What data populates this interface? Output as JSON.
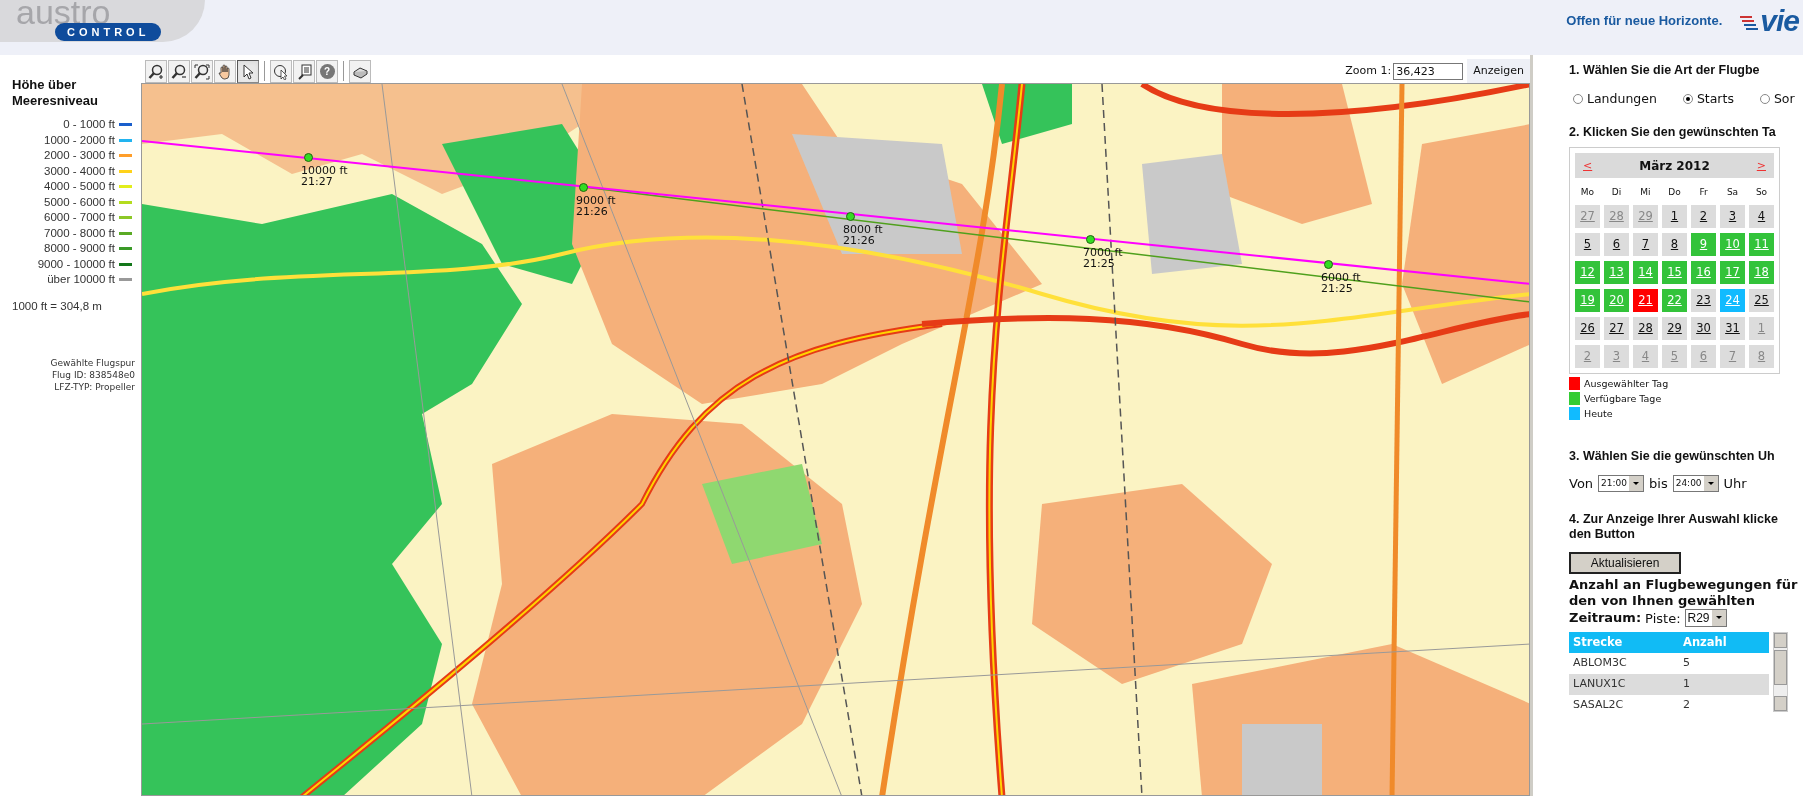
{
  "header": {
    "logo_top": "austro",
    "logo_badge": "CONTROL",
    "slogan": "Offen für neue Horizonte.",
    "airport_logo": "vie"
  },
  "toolbar": {
    "tools": [
      {
        "kind": "zoom_in",
        "selected": false
      },
      {
        "kind": "zoom_out",
        "selected": false
      },
      {
        "kind": "zoom_extent",
        "selected": false
      },
      {
        "kind": "pan",
        "selected": false
      },
      {
        "kind": "pointer",
        "selected": true
      },
      {
        "kind": "select",
        "selected": false
      },
      {
        "kind": "info",
        "selected": false
      },
      {
        "kind": "help",
        "label": "?",
        "selected": false
      },
      {
        "kind": "print",
        "selected": false
      }
    ],
    "zoom_label": "Zoom 1:",
    "zoom_value": "36,423",
    "zoom_button": "Anzeigen"
  },
  "legend": {
    "title": "Höhe über Meeresniveau",
    "items": [
      {
        "label": "0 - 1000 ft",
        "color": "#1a5fcc"
      },
      {
        "label": "1000 - 2000 ft",
        "color": "#22b4f0"
      },
      {
        "label": "2000 - 3000 ft",
        "color": "#ff9e2a"
      },
      {
        "label": "3000 - 4000 ft",
        "color": "#ffd21a"
      },
      {
        "label": "4000 - 5000 ft",
        "color": "#e2ee1c"
      },
      {
        "label": "5000 - 6000 ft",
        "color": "#b4dc1e"
      },
      {
        "label": "6000 - 7000 ft",
        "color": "#8cc828"
      },
      {
        "label": "7000 - 8000 ft",
        "color": "#5aaa24"
      },
      {
        "label": "8000 - 9000 ft",
        "color": "#3a9a28"
      },
      {
        "label": "9000 - 10000 ft",
        "color": "#13771a"
      },
      {
        "label": "über 10000 ft",
        "color": "#999999"
      }
    ],
    "conversion": "1000 ft = 304,8 m"
  },
  "flight_info": [
    "Gewählte Flugspur",
    "Flug ID: 838548e0",
    "LFZ-TYP: Propeller"
  ],
  "map": {
    "waypoints": [
      {
        "altitude": "10000 ft",
        "time": "21:27"
      },
      {
        "altitude": "9000 ft",
        "time": "21:26"
      },
      {
        "altitude": "8000 ft",
        "time": "21:26"
      },
      {
        "altitude": "7000 ft",
        "time": "21:25"
      },
      {
        "altitude": "6000 ft",
        "time": "21:25"
      }
    ]
  },
  "panel": {
    "step1": "1. Wählen Sie die Art  der Flugbe",
    "movement_types": [
      {
        "label": "Landungen",
        "selected": false
      },
      {
        "label": "Starts",
        "selected": true
      },
      {
        "label": "Sor",
        "selected": false
      }
    ],
    "step2": "2. Klicken Sie den gewünschten Ta",
    "calendar": {
      "prev": "<",
      "month": "März 2012",
      "next": ">",
      "weekdays": [
        "Mo",
        "Di",
        "Mi",
        "Do",
        "Fr",
        "Sa",
        "So"
      ],
      "days": [
        {
          "label": "27",
          "kind": "outside",
          "selected": false
        },
        {
          "label": "28",
          "kind": "outside",
          "selected": false
        },
        {
          "label": "29",
          "kind": "outside",
          "selected": false
        },
        {
          "label": "1",
          "kind": "plain",
          "selected": false
        },
        {
          "label": "2",
          "kind": "plain",
          "selected": false
        },
        {
          "label": "3",
          "kind": "plain",
          "selected": false
        },
        {
          "label": "4",
          "kind": "plain",
          "selected": false
        },
        {
          "label": "5",
          "kind": "plain",
          "selected": false
        },
        {
          "label": "6",
          "kind": "plain",
          "selected": false
        },
        {
          "label": "7",
          "kind": "plain",
          "selected": false
        },
        {
          "label": "8",
          "kind": "plain",
          "selected": false
        },
        {
          "label": "9",
          "kind": "available",
          "selected": false
        },
        {
          "label": "10",
          "kind": "available",
          "selected": false
        },
        {
          "label": "11",
          "kind": "available",
          "selected": false
        },
        {
          "label": "12",
          "kind": "available",
          "selected": false
        },
        {
          "label": "13",
          "kind": "available",
          "selected": false
        },
        {
          "label": "14",
          "kind": "available",
          "selected": false
        },
        {
          "label": "15",
          "kind": "available",
          "selected": false
        },
        {
          "label": "16",
          "kind": "available",
          "selected": false
        },
        {
          "label": "17",
          "kind": "available",
          "selected": false
        },
        {
          "label": "18",
          "kind": "available",
          "selected": false
        },
        {
          "label": "19",
          "kind": "available",
          "selected": false
        },
        {
          "label": "20",
          "kind": "available",
          "selected": false
        },
        {
          "label": "21",
          "kind": "available",
          "selected": true
        },
        {
          "label": "22",
          "kind": "available",
          "selected": false
        },
        {
          "label": "23",
          "kind": "plain",
          "selected": false
        },
        {
          "label": "24",
          "kind": "today",
          "selected": false
        },
        {
          "label": "25",
          "kind": "plain",
          "selected": false
        },
        {
          "label": "26",
          "kind": "plain",
          "selected": false
        },
        {
          "label": "27",
          "kind": "plain",
          "selected": false
        },
        {
          "label": "28",
          "kind": "plain",
          "selected": false
        },
        {
          "label": "29",
          "kind": "plain",
          "selected": false
        },
        {
          "label": "30",
          "kind": "plain",
          "selected": false
        },
        {
          "label": "31",
          "kind": "plain",
          "selected": false
        },
        {
          "label": "1",
          "kind": "outside",
          "selected": false
        },
        {
          "label": "2",
          "kind": "outside",
          "selected": false
        },
        {
          "label": "3",
          "kind": "outside",
          "selected": false
        },
        {
          "label": "4",
          "kind": "outside",
          "selected": false
        },
        {
          "label": "5",
          "kind": "outside",
          "selected": false
        },
        {
          "label": "6",
          "kind": "outside",
          "selected": false
        },
        {
          "label": "7",
          "kind": "outside",
          "selected": false
        },
        {
          "label": "8",
          "kind": "outside",
          "selected": false
        }
      ]
    },
    "calendar_legend": [
      {
        "label": "Ausgewählter Tag",
        "color": "#ff0000"
      },
      {
        "label": "Verfügbare Tage",
        "color": "#33cc33"
      },
      {
        "label": "Heute",
        "color": "#11bbff"
      }
    ],
    "step3": "3. Wählen Sie die gewünschten Uh",
    "time_from_label": "Von",
    "time_from": "21:00",
    "time_to_label": "bis",
    "time_to": "24:00",
    "time_unit": "Uhr",
    "step4": [
      "4. Zur Anzeige Ihrer Auswahl klicke",
      "den Button"
    ],
    "update_button": "Aktualisieren",
    "count_title": [
      "Anzahl an Flugbewegungen für",
      "den von Ihnen gewählten",
      "Zeitraum:"
    ],
    "runway_label": "Piste:",
    "runway": "R29",
    "table": {
      "columns": [
        "Strecke",
        "Anzahl"
      ],
      "rows": [
        [
          "ABLOM3C",
          "5"
        ],
        [
          "LANUX1C",
          "1"
        ],
        [
          "SASAL2C",
          "2"
        ]
      ]
    }
  }
}
